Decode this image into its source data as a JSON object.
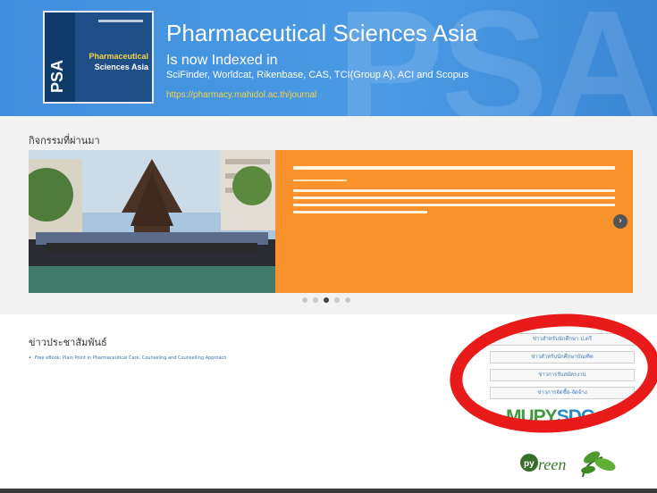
{
  "banner": {
    "bg_text": "PSA",
    "cover": {
      "psa": "PSA",
      "title_line1": "Pharmaceutical",
      "title_line2": "Sciences Asia"
    },
    "title": "Pharmaceutical Sciences Asia",
    "subtitle": "Is now Indexed in",
    "indexed": "SciFinder, Worldcat, Rikenbase, CAS, TCI(Group A), ACI and Scopus",
    "url": "https://pharmacy.mahidol.ac.th/journal"
  },
  "activities": {
    "title": "กิจกรรมที่ผ่านมา",
    "next_icon": "chevron-right-icon",
    "dots": 5,
    "active_dot": 3
  },
  "news": {
    "title": "ข่าวประชาสัมพันธ์",
    "items": [
      "Free eBook: Plain Point in Pharmaceutical Care, Counseling and Counselling Approach"
    ]
  },
  "side_links": [
    "ข่าวสำหรับนักศึกษา ป.ตรี",
    "ข่าวสำหรับนักศึกษาบัณฑิต",
    "ข่าวการรับสมัครงาน",
    "ข่าวการจัดซื้อ-จัดจ้าง"
  ],
  "logos": {
    "sdg": "MUPYSDGs",
    "green_py": "py",
    "green_word": "reen"
  },
  "colors": {
    "banner_blue": "#4b9ae4",
    "slide_orange": "#f9922a",
    "annotation_red": "#e81a1a",
    "link_blue": "#4178b8"
  }
}
